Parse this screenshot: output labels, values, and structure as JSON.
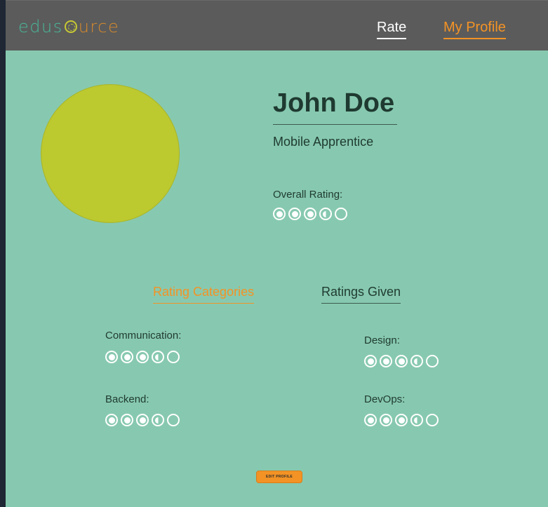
{
  "header": {
    "logo_text_start": "edus",
    "logo_text_end": "urce",
    "nav": [
      {
        "label": "Rate"
      },
      {
        "label": "My Profile"
      }
    ]
  },
  "profile": {
    "name": "John Doe",
    "job_title": "Mobile Apprentice",
    "overall_label": "Overall Rating:",
    "overall_rating": 3.5,
    "overall_rating_max": 5
  },
  "tabs": [
    {
      "label": "Rating Categories",
      "active": true
    },
    {
      "label": "Ratings Given",
      "active": false
    }
  ],
  "categories": [
    {
      "label": "Communication:",
      "rating": 3.5,
      "max": 5
    },
    {
      "label": "Design:",
      "rating": 3.5,
      "max": 5
    },
    {
      "label": "Backend:",
      "rating": 3.5,
      "max": 5
    },
    {
      "label": "DevOps:",
      "rating": 3.5,
      "max": 5
    }
  ],
  "actions": {
    "edit_profile_label": "EDIT PROFILE"
  },
  "colors": {
    "accent": "#f39325",
    "page_bg": "#87c9b0",
    "header_bg": "#5b5b5b",
    "avatar": "#bcc92f"
  }
}
